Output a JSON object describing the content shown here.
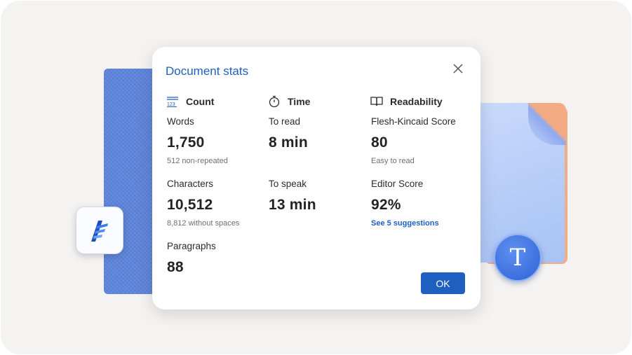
{
  "dialog": {
    "title": "Document stats",
    "ok_label": "OK"
  },
  "columns": {
    "count": {
      "heading": "Count",
      "icon": "numbers-icon",
      "stats": [
        {
          "label": "Words",
          "value": "1,750",
          "sub": "512 non-repeated"
        },
        {
          "label": "Characters",
          "value": "10,512",
          "sub": "8,812 without spaces"
        },
        {
          "label": "Paragraphs",
          "value": "88"
        }
      ]
    },
    "time": {
      "heading": "Time",
      "icon": "stopwatch-icon",
      "stats": [
        {
          "label": "To read",
          "value": "8 min"
        },
        {
          "label": "To speak",
          "value": "13 min"
        }
      ]
    },
    "readability": {
      "heading": "Readability",
      "icon": "book-icon",
      "stats": [
        {
          "label": "Flesh-Kincaid Score",
          "value": "80",
          "sub": "Easy to read"
        },
        {
          "label": "Editor Score",
          "value": "92%",
          "link": "See 5 suggestions"
        }
      ]
    }
  },
  "decor": {
    "t_glyph": "T"
  },
  "colors": {
    "accent": "#1f5fbf",
    "background": "#f4f3f1"
  }
}
